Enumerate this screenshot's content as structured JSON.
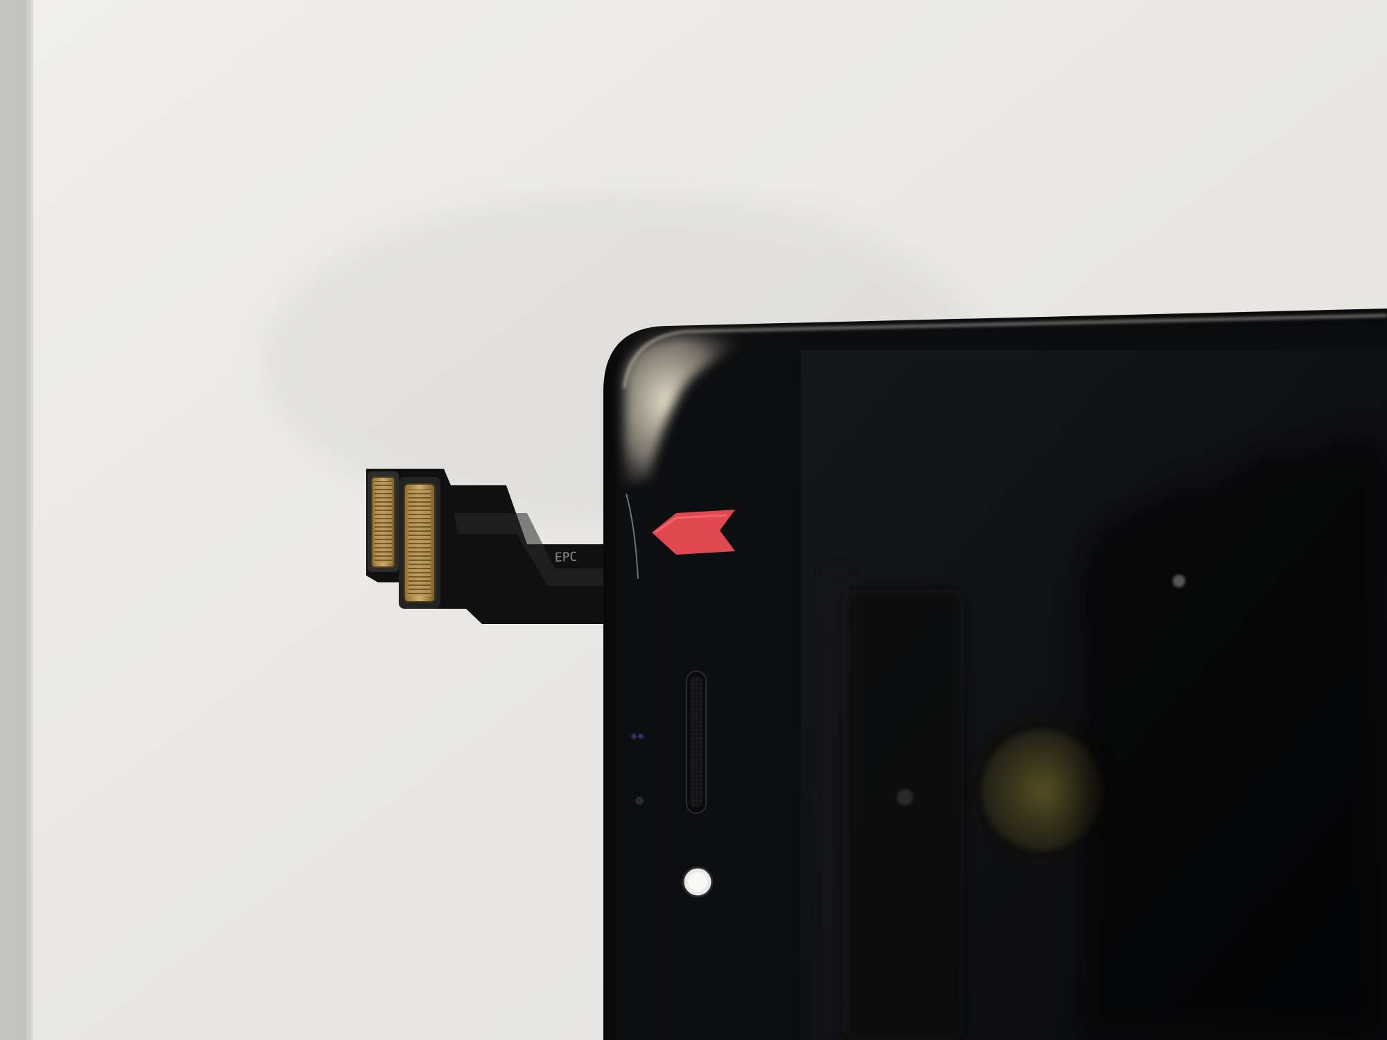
{
  "scene": {
    "kind": "photo",
    "subject": "smartphone-display-assembly-corner",
    "colors": {
      "paper": "#ecebe8",
      "paper_shadow": "#dcdcd8",
      "left_strip": "#bfc0bb",
      "phone_body": "#0c0c0d",
      "phone_glass": "#111214",
      "display_area": "#141619",
      "flex_cable": "#121212",
      "connector_gold": "#c2a15f",
      "arrow_sticker": "#e0494f",
      "highlight": "#f2eadb"
    },
    "flex_cable": {
      "printed_text": "EPC"
    }
  }
}
